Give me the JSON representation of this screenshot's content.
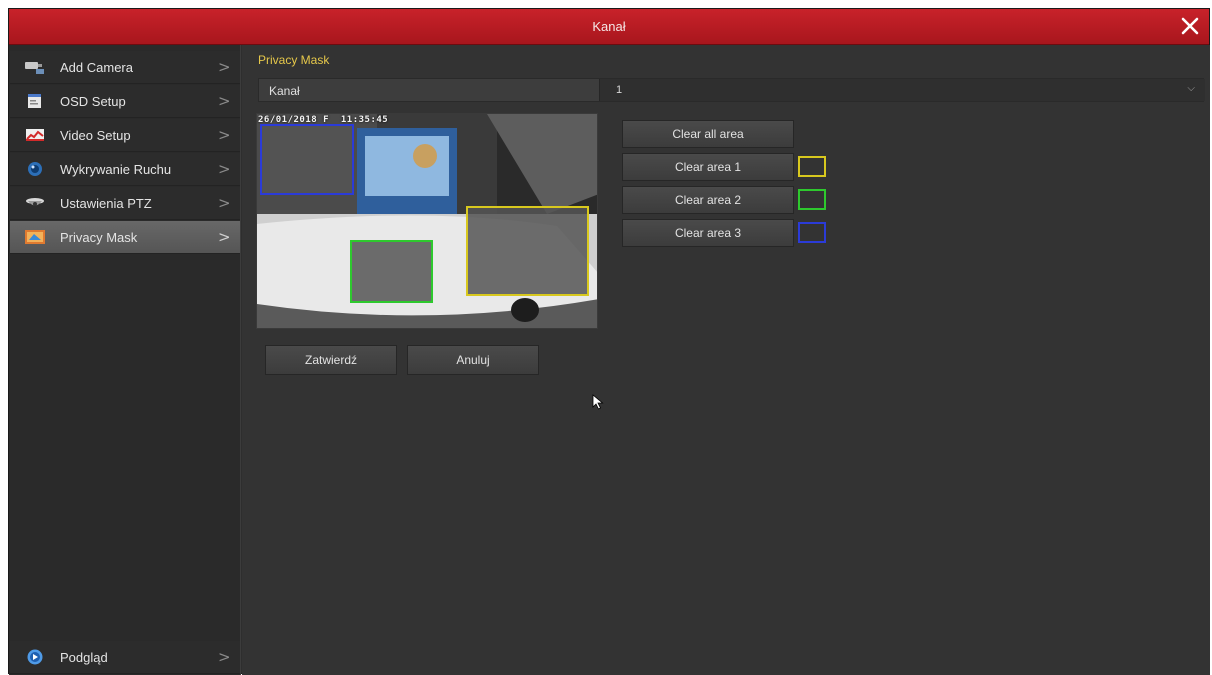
{
  "window": {
    "title": "Kanał"
  },
  "sidebar": {
    "items": [
      {
        "label": "Add Camera",
        "icon": "camera-icon",
        "active": false
      },
      {
        "label": "OSD Setup",
        "icon": "osd-icon",
        "active": false
      },
      {
        "label": "Video Setup",
        "icon": "video-setup-icon",
        "active": false
      },
      {
        "label": "Wykrywanie Ruchu",
        "icon": "motion-detection-icon",
        "active": false
      },
      {
        "label": "Ustawienia PTZ",
        "icon": "ptz-icon",
        "active": false
      },
      {
        "label": "Privacy Mask",
        "icon": "privacy-mask-icon",
        "active": true
      }
    ],
    "bottom": {
      "label": "Podgląd",
      "icon": "preview-icon"
    }
  },
  "main": {
    "section_title": "Privacy Mask",
    "kanal": {
      "label": "Kanał",
      "value": "1"
    },
    "preview": {
      "timestamp": "26/01/2018 F  11:35:45"
    },
    "buttons": {
      "clear_all": "Clear all area",
      "clear_1": "Clear area 1",
      "clear_2": "Clear area 2",
      "clear_3": "Clear area 3",
      "confirm": "Zatwierdź",
      "cancel": "Anuluj"
    },
    "area_colors": {
      "area_1": "#d8c81e",
      "area_2": "#2ec92e",
      "area_3": "#2b3bd8"
    }
  },
  "colors": {
    "accent": "#b81c23",
    "section_title": "#e6c84a"
  }
}
